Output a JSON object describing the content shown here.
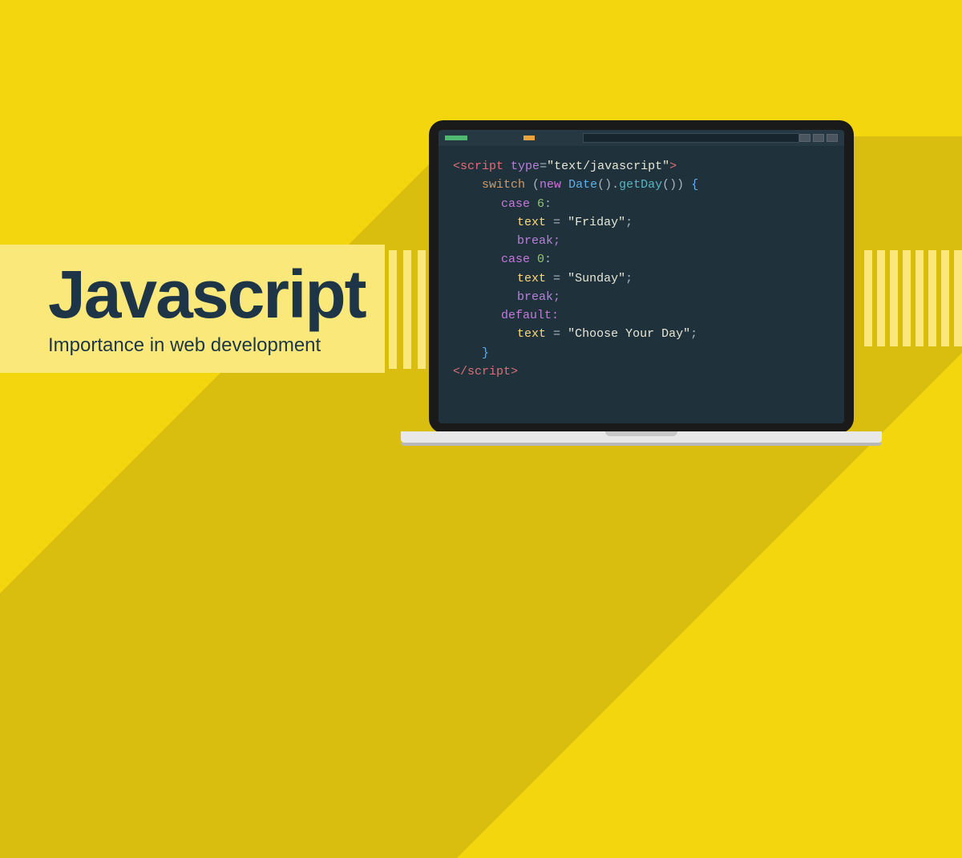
{
  "title": "Javascript",
  "subtitle": "Importance in web development",
  "code": {
    "open_tag": "script",
    "attr_name": "type",
    "attr_value": "\"text/javascript\"",
    "switch": "switch",
    "new": "new",
    "class": "Date",
    "method": "getDay",
    "brace_open": "{",
    "brace_close": "}",
    "parens": "()",
    "case": "case",
    "case1_val": "6",
    "text_var": "text",
    "eq": "=",
    "str1": "\"Friday\"",
    "break": "break;",
    "case2_val": "0",
    "str2": "\"Sunday\"",
    "default": "default:",
    "str3": "\"Choose Your Day\"",
    "close_tag": "script",
    "lt": "<",
    "gt": ">",
    "lts": "</",
    "colon": ":",
    "semi": ";",
    "paren_open": "(",
    "paren_close": ")",
    "dot": "."
  }
}
